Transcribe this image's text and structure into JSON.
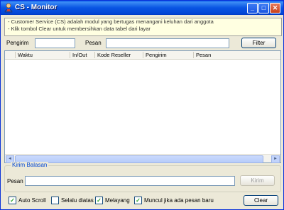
{
  "window": {
    "title": "CS - Monitor"
  },
  "titlebar": {
    "minimize": "_",
    "maximize": "□",
    "close": "✕"
  },
  "info": {
    "lines": [
      "- Customer Service (CS) adalah modul yang bertugas menangani keluhan dari anggota",
      "- Klik tombol Clear untuk membersihkan data tabel dari layar"
    ]
  },
  "filter": {
    "pengirim_label": "Pengirim",
    "pengirim_value": "",
    "pesan_label": "Pesan",
    "pesan_value": "",
    "button": "Filter"
  },
  "table": {
    "columns": [
      "Waktu",
      "In/Out",
      "Kode Reseller",
      "Pengirim",
      "Pesan"
    ],
    "rows": []
  },
  "scrollbar": {
    "left": "◄",
    "right": "►"
  },
  "reply": {
    "group_title": "Kirim Balasan",
    "pesan_label": "Pesan",
    "pesan_value": "",
    "button": "Kirim"
  },
  "options": [
    {
      "label": "Auto Scroll",
      "checked": true
    },
    {
      "label": "Selalu diatas",
      "checked": false
    },
    {
      "label": "Melayang",
      "checked": true
    },
    {
      "label": "Muncul jika ada pesan baru",
      "checked": true
    }
  ],
  "clear_button": "Clear"
}
